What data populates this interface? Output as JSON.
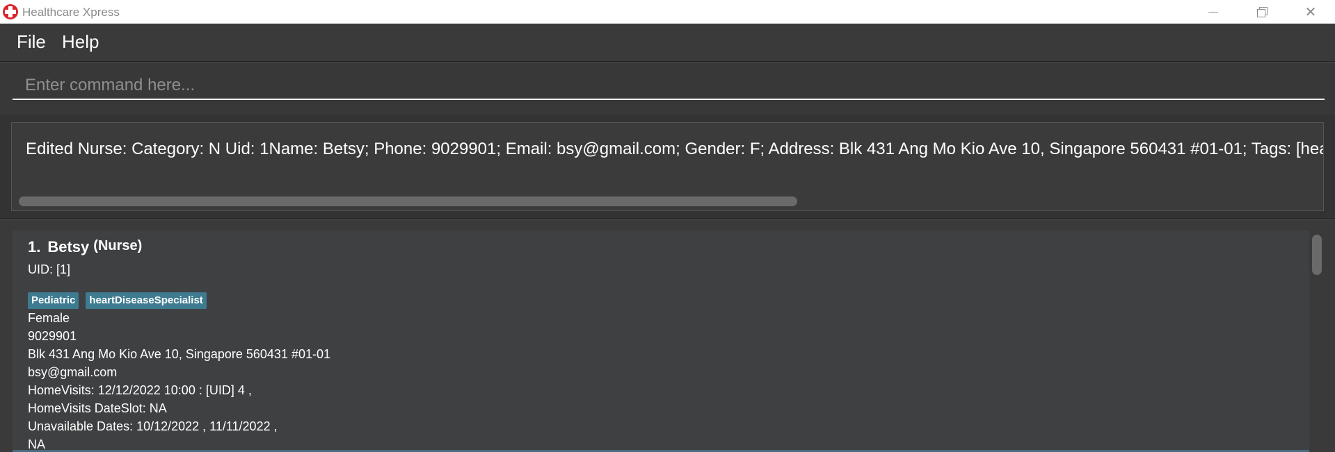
{
  "window": {
    "title": "Healthcare Xpress"
  },
  "menu": {
    "file_label": "File",
    "help_label": "Help"
  },
  "command": {
    "placeholder": "Enter command here..."
  },
  "result": {
    "text": "Edited Nurse: Category: N Uid: 1Name: Betsy; Phone: 9029901; Email: bsy@gmail.com; Gender: F; Address: Blk 431 Ang Mo Kio Ave 10, Singapore 560431 #01-01; Tags: [hear"
  },
  "persons": [
    {
      "index": "1.",
      "name": "Betsy",
      "category": "(Nurse)",
      "uid": "UID: [1]",
      "tags": [
        "Pediatric",
        "heartDiseaseSpecialist"
      ],
      "gender": "Female",
      "phone": "9029901",
      "address": "Blk 431 Ang Mo Kio Ave 10, Singapore 560431 #01-01",
      "email": "bsy@gmail.com",
      "home_visits": "HomeVisits: 12/12/2022 10:00 : [UID] 4 ,",
      "home_visits_dateslot": "HomeVisits DateSlot: NA",
      "unavailable_dates": "Unavailable Dates: 10/12/2022 , 11/11/2022 ,",
      "extra": "NA"
    }
  ],
  "colors": {
    "background": "#2b2b2b",
    "tag": "#3e7b91",
    "card": "#3f4042",
    "app_icon": "#d9262d"
  }
}
